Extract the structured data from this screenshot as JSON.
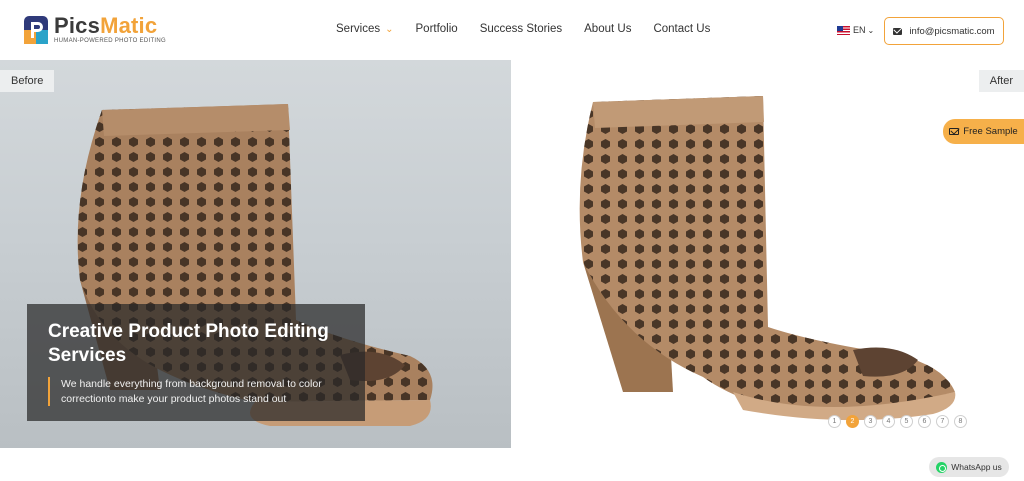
{
  "brand": {
    "name_part1": "Pics",
    "name_part2": "Matic",
    "tagline": "HUMAN-POWERED PHOTO EDITING"
  },
  "nav": {
    "items": [
      {
        "label": "Services",
        "has_dropdown": true
      },
      {
        "label": "Portfolio"
      },
      {
        "label": "Success Stories"
      },
      {
        "label": "About Us"
      },
      {
        "label": "Contact Us"
      }
    ]
  },
  "header": {
    "language": "EN",
    "email": "info@picsmatic.com"
  },
  "hero": {
    "before_label": "Before",
    "after_label": "After",
    "title": "Creative Product Photo Editing Services",
    "description": "We handle everything from background removal to color correctionto make your product photos stand out",
    "free_sample_label": "Free Sample"
  },
  "pager": {
    "pages": [
      "1",
      "2",
      "3",
      "4",
      "5",
      "6",
      "7",
      "8"
    ],
    "active": "2"
  },
  "whatsapp": {
    "label": "WhatsApp us"
  },
  "colors": {
    "accent": "#f2a33a",
    "shoe": "#b08662",
    "before_bg": "#c8ced2"
  }
}
